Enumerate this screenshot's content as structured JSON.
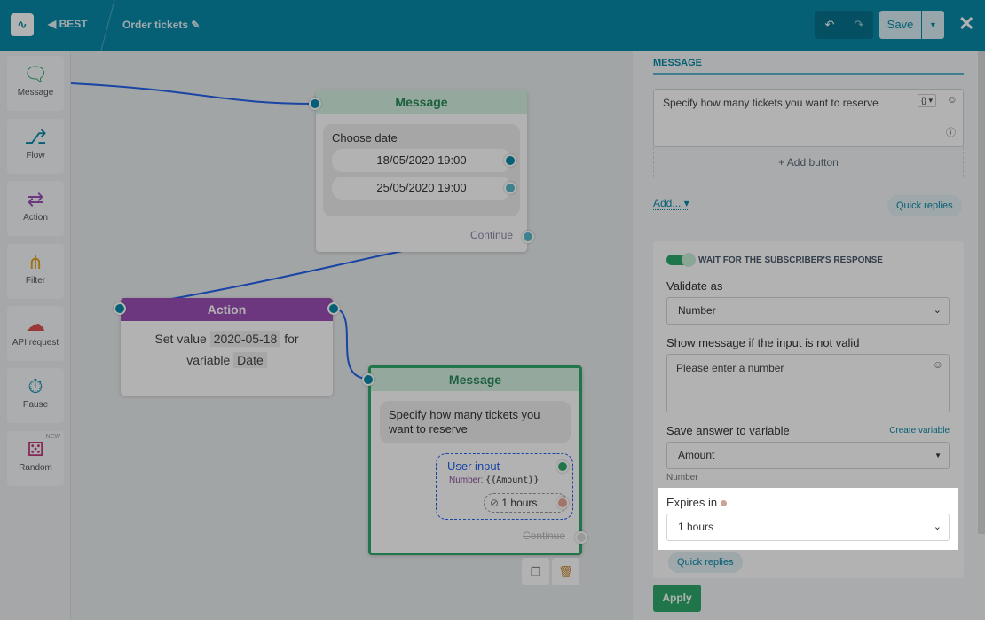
{
  "header": {
    "brand": "BEST",
    "flow_name": "Order tickets",
    "save": "Save"
  },
  "sidebar": {
    "items": [
      {
        "label": "Message",
        "icon": "message-icon"
      },
      {
        "label": "Flow",
        "icon": "flow-icon"
      },
      {
        "label": "Action",
        "icon": "action-icon"
      },
      {
        "label": "Filter",
        "icon": "filter-icon"
      },
      {
        "label": "API request",
        "icon": "cloud-icon"
      },
      {
        "label": "Pause",
        "icon": "stopwatch-icon"
      },
      {
        "label": "Random",
        "icon": "dice-icon",
        "badge": "NEW"
      }
    ]
  },
  "canvas": {
    "node1": {
      "title": "Message",
      "text": "Choose date",
      "buttons": [
        "18/05/2020 19:00",
        "25/05/2020 19:00"
      ],
      "continue": "Continue"
    },
    "node2": {
      "title": "Action",
      "t1": "Set value",
      "value": "2020-05-18",
      "t2": "for",
      "t3": "variable",
      "var": "Date"
    },
    "node3": {
      "title": "Message",
      "text": "Specify how many tickets you want to reserve",
      "input_title": "User input",
      "input_type": "Number:",
      "input_var": "{{Amount}}",
      "timeout": "1 hours",
      "continue": "Continue"
    }
  },
  "panel": {
    "section": "MESSAGE",
    "message": "Specify how many tickets you want to reserve",
    "add_button": "+ Add button",
    "add": "Add...",
    "quick_replies": "Quick replies",
    "wait_label": "WAIT FOR THE SUBSCRIBER'S RESPONSE",
    "wait_on": true,
    "validate_label": "Validate as",
    "validate_value": "Number",
    "invalid_label": "Show message if the input is not valid",
    "invalid_value": "Please enter a number",
    "save_label": "Save answer to variable",
    "create_variable": "Create variable",
    "variable_value": "Amount",
    "variable_type": "Number",
    "expires_label": "Expires in",
    "expires_value": "1 hours",
    "quick_replies2": "Quick replies",
    "apply": "Apply"
  },
  "colors": {
    "brand": "#0a8aa8",
    "message": "#2eaa6a",
    "action": "#9b4fb5"
  }
}
